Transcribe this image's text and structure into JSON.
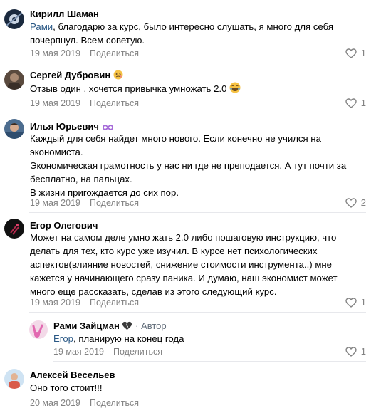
{
  "comments": [
    {
      "name": "Кирилл Шаман",
      "mention": "Рами",
      "lines": [
        ", благодарю за курс, было интересно слушать, я много для себя",
        "почерпнул. Всем советую."
      ],
      "date": "19 мая 2019",
      "share": "Поделиться",
      "likes": "1"
    },
    {
      "name": "Сергей Дубровин",
      "lines": [
        "Отзыв один , хочется привычка умножать 2.0"
      ],
      "date": "19 мая 2019",
      "share": "Поделиться",
      "likes": "1"
    },
    {
      "name": "Илья Юрьевич",
      "lines": [
        "Каждый для себя найдет много нового. Если конечно не учился на",
        "экономиста.",
        "Экономическая грамотность у нас ни где не преподается. А тут почти за",
        "бесплатно, на пальцах.",
        "В жизни пригождается до сих пор."
      ],
      "date": "19 мая 2019",
      "share": "Поделиться",
      "likes": "2"
    },
    {
      "name": "Егор Олегович",
      "lines": [
        "Может на самом деле умно жать 2.0 либо пошаговую инструкцию, что",
        "делать для тех, кто курс уже изучил. В курсе нет психологических",
        "аспектов(влияние новостей, снижение стоимости инструмента..) мне",
        "кажется у начинающего сразу паника. И думаю, наш экономист может",
        "много еще рассказать, сделав из этого следующий курс."
      ],
      "date": "19 мая 2019",
      "share": "Поделиться",
      "likes": "1"
    },
    {
      "name": "Рами Зайцман",
      "author_tag": " · Автор",
      "mention": "Егор",
      "lines": [
        ", планирую на конец года"
      ],
      "date": "19 мая 2019",
      "share": "Поделиться",
      "likes": "1"
    },
    {
      "name": "Алексей Весельев",
      "lines": [
        "Оно того стоит!!!"
      ],
      "date": "20 мая 2019",
      "share": "Поделиться"
    }
  ],
  "colors": {
    "link": "#2a5885",
    "meta": "#828282",
    "divider": "#e7e8ec"
  },
  "icons": {
    "like": "heart-outline-icon",
    "emoji_2": "woozy-face-emoji",
    "emoji_laugh": "tears-of-joy-emoji",
    "emoji_infinity": "infinity-emoji",
    "emoji_heart": "black-heart-emoji"
  }
}
